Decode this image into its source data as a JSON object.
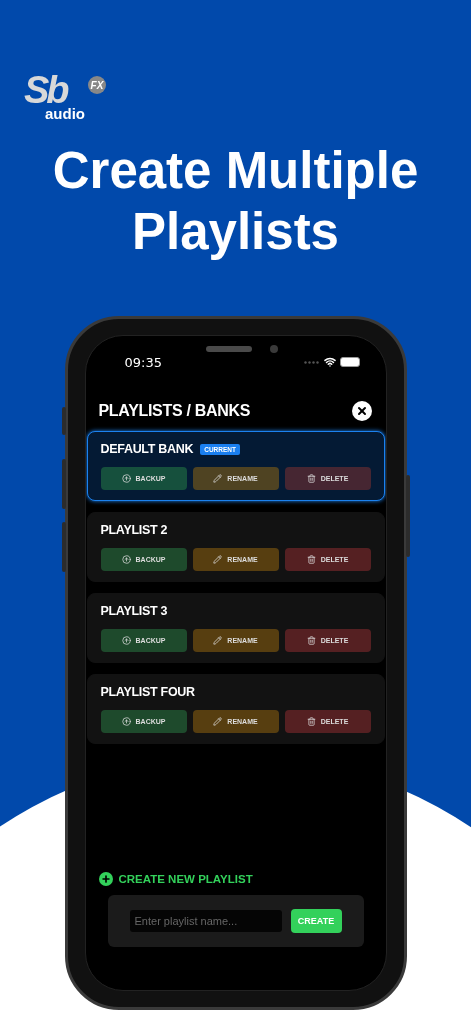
{
  "logo": {
    "mark": "Sb",
    "sub": "FX",
    "word": "audio"
  },
  "headline": "Create Multiple Playlists",
  "status_bar": {
    "time": "09:35"
  },
  "screen": {
    "title": "PLAYLISTS / BANKS",
    "playlists": [
      {
        "name": "DEFAULT BANK",
        "selected": true,
        "badge": "CURRENT",
        "actions": [
          {
            "kind": "backup",
            "label": "BACKUP"
          },
          {
            "kind": "rename",
            "label": "RENAME"
          },
          {
            "kind": "delete",
            "label": "DELETE"
          }
        ]
      },
      {
        "name": "PLAYLIST 2",
        "selected": false,
        "actions": [
          {
            "kind": "backup",
            "label": "BACKUP"
          },
          {
            "kind": "rename",
            "label": "RENAME"
          },
          {
            "kind": "delete",
            "label": "DELETE"
          }
        ]
      },
      {
        "name": "PLAYLIST 3",
        "selected": false,
        "actions": [
          {
            "kind": "backup",
            "label": "BACKUP"
          },
          {
            "kind": "rename",
            "label": "RENAME"
          },
          {
            "kind": "delete",
            "label": "DELETE"
          }
        ]
      },
      {
        "name": "PLAYLIST FOUR",
        "selected": false,
        "actions": [
          {
            "kind": "backup",
            "label": "BACKUP"
          },
          {
            "kind": "rename",
            "label": "RENAME"
          },
          {
            "kind": "delete",
            "label": "DELETE"
          }
        ]
      }
    ],
    "create": {
      "label": "CREATE NEW PLAYLIST",
      "placeholder": "Enter playlist name...",
      "button": "CREATE"
    }
  }
}
